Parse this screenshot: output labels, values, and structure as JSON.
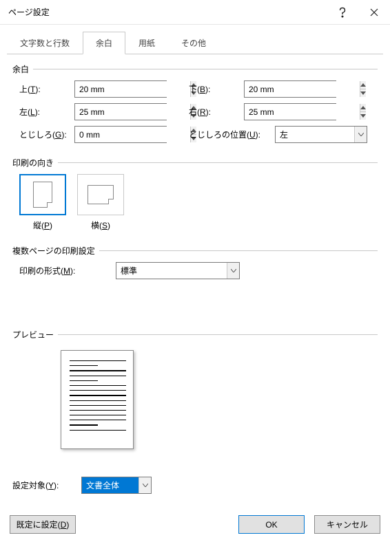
{
  "window": {
    "title": "ページ設定"
  },
  "tabs": {
    "chars": "文字数と行数",
    "margins": "余白",
    "paper": "用紙",
    "other": "その他",
    "active": "margins"
  },
  "margins": {
    "legend": "余白",
    "top_label_prefix": "上(",
    "top_label_key": "T",
    "top_label_suffix": "):",
    "top_value": "20 mm",
    "bottom_label_prefix": "下(",
    "bottom_label_key": "B",
    "bottom_label_suffix": "):",
    "bottom_value": "20 mm",
    "left_label_prefix": "左(",
    "left_label_key": "L",
    "left_label_suffix": "):",
    "left_value": "25 mm",
    "right_label_prefix": "右(",
    "right_label_key": "R",
    "right_label_suffix": "):",
    "right_value": "25 mm",
    "gutter_label_prefix": "とじしろ(",
    "gutter_label_key": "G",
    "gutter_label_suffix": "):",
    "gutter_value": "0 mm",
    "gutter_pos_label_prefix": "とじしろの位置(",
    "gutter_pos_label_key": "U",
    "gutter_pos_label_suffix": "):",
    "gutter_pos_value": "左"
  },
  "orientation": {
    "legend": "印刷の向き",
    "portrait_prefix": "縦(",
    "portrait_key": "P",
    "portrait_suffix": ")",
    "landscape_prefix": "横(",
    "landscape_key": "S",
    "landscape_suffix": ")",
    "selected": "portrait"
  },
  "multipage": {
    "legend": "複数ページの印刷設定",
    "format_label_prefix": "印刷の形式(",
    "format_label_key": "M",
    "format_label_suffix": "):",
    "format_value": "標準"
  },
  "preview": {
    "legend": "プレビュー"
  },
  "applyto": {
    "label_prefix": "設定対象(",
    "label_key": "Y",
    "label_suffix": "):",
    "value": "文書全体"
  },
  "buttons": {
    "default_prefix": "既定に設定(",
    "default_key": "D",
    "default_suffix": ")",
    "ok": "OK",
    "cancel": "キャンセル"
  }
}
